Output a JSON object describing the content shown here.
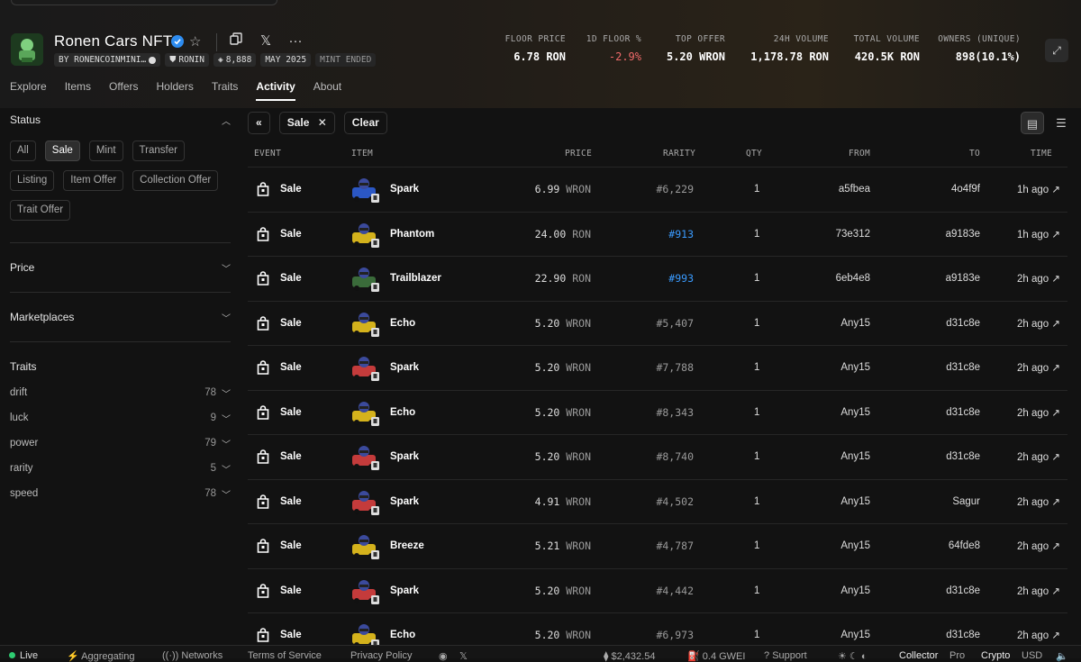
{
  "collection": {
    "title": "Ronen Cars NFT",
    "creator": "BY RONENCOINMINI…",
    "chain": "RONIN",
    "supply": "8,888",
    "date": "MAY 2025",
    "status": "MINT ENDED"
  },
  "stats": [
    {
      "label": "FLOOR PRICE",
      "value": "6.78 RON"
    },
    {
      "label": "1D FLOOR %",
      "value": "-2.9%"
    },
    {
      "label": "TOP OFFER",
      "value": "5.20 WRON"
    },
    {
      "label": "24H VOLUME",
      "value": "1,178.78 RON"
    },
    {
      "label": "TOTAL VOLUME",
      "value": "420.5K RON"
    },
    {
      "label": "OWNERS (UNIQUE)",
      "value": "898(10.1%)"
    }
  ],
  "tabs": [
    "Explore",
    "Items",
    "Offers",
    "Holders",
    "Traits",
    "Activity",
    "About"
  ],
  "sidebar": {
    "status_label": "Status",
    "status_filters": [
      "All",
      "Sale",
      "Mint",
      "Transfer",
      "Listing",
      "Item Offer",
      "Collection Offer",
      "Trait Offer"
    ],
    "price_label": "Price",
    "marketplaces_label": "Marketplaces",
    "traits_label": "Traits",
    "traits": [
      {
        "name": "drift",
        "count": "78"
      },
      {
        "name": "luck",
        "count": "9"
      },
      {
        "name": "power",
        "count": "79"
      },
      {
        "name": "rarity",
        "count": "5"
      },
      {
        "name": "speed",
        "count": "78"
      }
    ]
  },
  "toolbar": {
    "active_filter": "Sale",
    "clear_label": "Clear"
  },
  "columns": [
    "EVENT",
    "ITEM",
    "PRICE",
    "RARITY",
    "QTY",
    "FROM",
    "TO",
    "TIME"
  ],
  "rows": [
    {
      "event": "Sale",
      "item": "Spark",
      "price": "6.99",
      "currency": "WRON",
      "rarity": "#6,229",
      "rare": false,
      "qty": "1",
      "from": "a5fbea",
      "to": "4o4f9f",
      "time": "1h ago",
      "color": "#2b57c4"
    },
    {
      "event": "Sale",
      "item": "Phantom",
      "price": "24.00",
      "currency": "RON",
      "rarity": "#913",
      "rare": true,
      "qty": "1",
      "from": "73e312",
      "to": "a9183e",
      "time": "1h ago",
      "color": "#d4b21c"
    },
    {
      "event": "Sale",
      "item": "Trailblazer",
      "price": "22.90",
      "currency": "RON",
      "rarity": "#993",
      "rare": true,
      "qty": "1",
      "from": "6eb4e8",
      "to": "a9183e",
      "time": "2h ago",
      "color": "#3a6b3a"
    },
    {
      "event": "Sale",
      "item": "Echo",
      "price": "5.20",
      "currency": "WRON",
      "rarity": "#5,407",
      "rare": false,
      "qty": "1",
      "from": "Any15",
      "to": "d31c8e",
      "time": "2h ago",
      "color": "#d4b21c"
    },
    {
      "event": "Sale",
      "item": "Spark",
      "price": "5.20",
      "currency": "WRON",
      "rarity": "#7,788",
      "rare": false,
      "qty": "1",
      "from": "Any15",
      "to": "d31c8e",
      "time": "2h ago",
      "color": "#c43b3b"
    },
    {
      "event": "Sale",
      "item": "Echo",
      "price": "5.20",
      "currency": "WRON",
      "rarity": "#8,343",
      "rare": false,
      "qty": "1",
      "from": "Any15",
      "to": "d31c8e",
      "time": "2h ago",
      "color": "#d4b21c"
    },
    {
      "event": "Sale",
      "item": "Spark",
      "price": "5.20",
      "currency": "WRON",
      "rarity": "#8,740",
      "rare": false,
      "qty": "1",
      "from": "Any15",
      "to": "d31c8e",
      "time": "2h ago",
      "color": "#c43b3b"
    },
    {
      "event": "Sale",
      "item": "Spark",
      "price": "4.91",
      "currency": "WRON",
      "rarity": "#4,502",
      "rare": false,
      "qty": "1",
      "from": "Any15",
      "to": "Sagur",
      "time": "2h ago",
      "color": "#c43b3b"
    },
    {
      "event": "Sale",
      "item": "Breeze",
      "price": "5.21",
      "currency": "WRON",
      "rarity": "#4,787",
      "rare": false,
      "qty": "1",
      "from": "Any15",
      "to": "64fde8",
      "time": "2h ago",
      "color": "#d4b21c"
    },
    {
      "event": "Sale",
      "item": "Spark",
      "price": "5.20",
      "currency": "WRON",
      "rarity": "#4,442",
      "rare": false,
      "qty": "1",
      "from": "Any15",
      "to": "d31c8e",
      "time": "2h ago",
      "color": "#c43b3b"
    },
    {
      "event": "Sale",
      "item": "Echo",
      "price": "5.20",
      "currency": "WRON",
      "rarity": "#6,973",
      "rare": false,
      "qty": "1",
      "from": "Any15",
      "to": "d31c8e",
      "time": "2h ago",
      "color": "#d4b21c"
    }
  ],
  "footer": {
    "live": "Live",
    "aggregating": "Aggregating",
    "networks": "Networks",
    "terms": "Terms of Service",
    "privacy": "Privacy Policy",
    "eth_price": "$2,432.54",
    "gas": "0.4 GWEI",
    "support": "Support",
    "mode_collector": "Collector",
    "mode_pro": "Pro",
    "currency_crypto": "Crypto",
    "currency_usd": "USD"
  }
}
